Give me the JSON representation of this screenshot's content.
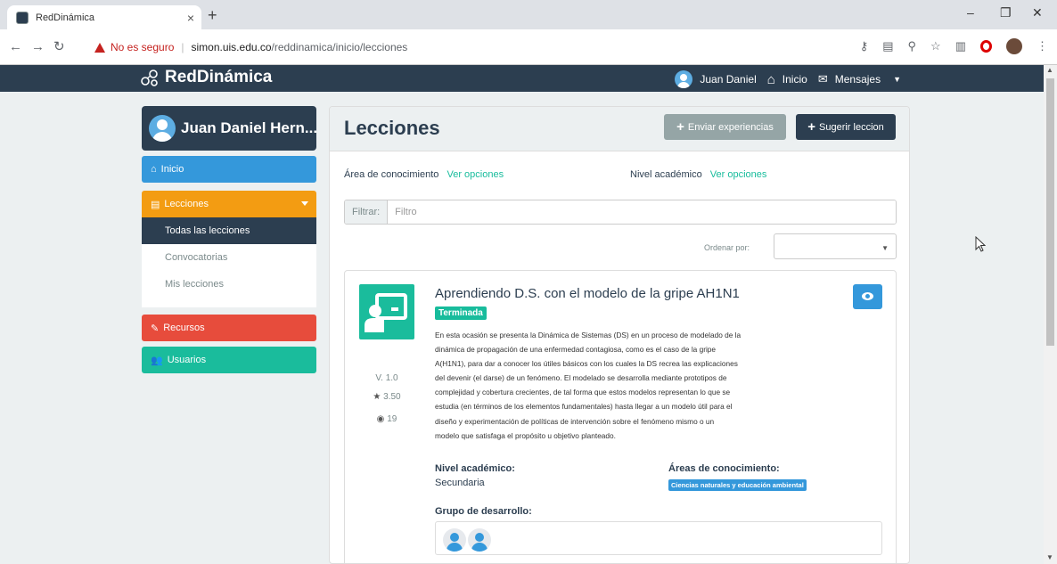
{
  "browser": {
    "tab_title": "RedDinámica",
    "tab_close": "×",
    "new_tab": "+",
    "not_secure": "No es seguro",
    "url_host": "simon.uis.edu.co",
    "url_path": "/reddinamica/inicio/lecciones",
    "window_controls": [
      "–",
      "❐",
      "✕"
    ]
  },
  "site": {
    "brand": "RedDinámica",
    "user_short": "Juan Daniel",
    "nav_inicio": "Inicio",
    "nav_mensajes": "Mensajes"
  },
  "sidebar": {
    "user_name": "Juan Daniel Hern...",
    "inicio": "Inicio",
    "lecciones": "Lecciones",
    "submenu": [
      "Todas las lecciones",
      "Convocatorias",
      "Mis lecciones"
    ],
    "recursos": "Recursos",
    "usuarios": "Usuarios"
  },
  "main": {
    "title": "Lecciones",
    "btn_enviar": "Enviar experiencias",
    "btn_sugerir": "Sugerir leccion",
    "area_label": "Área de conocimiento",
    "area_link": "Ver opciones",
    "nivel_label": "Nivel académico",
    "nivel_link": "Ver opciones",
    "filter_addon": "Filtrar:",
    "filter_placeholder": "Filtro",
    "sort_label": "Ordenar por:"
  },
  "lesson": {
    "title": "Aprendiendo D.S. con el modelo de la gripe AH1N1",
    "status": "Terminada",
    "version": "V. 1.0",
    "rating": "3.50",
    "views": "19",
    "description_lines": [
      "En esta ocasión se presenta la Dinámica de Sistemas (DS) en un proceso de modelado de la",
      "dinámica de propagación de una enfermedad contagiosa, como es el caso de la gripe",
      "A(H1N1), para dar a conocer los útiles básicos con los cuales la DS recrea las explicaciones",
      "del devenir (el darse) de un fenómeno. El modelado se desarrolla mediante prototipos de",
      "complejidad y cobertura crecientes, de tal forma que estos modelos representan lo que se",
      "estudia (en términos de los elementos fundamentales) hasta llegar a un modelo útil para el",
      "diseño y experimentación de políticas de intervención sobre el fenómeno mismo o un",
      "modelo que satisfaga el propósito u objetivo planteado."
    ],
    "nivel_label": "Nivel académico:",
    "nivel_value": "Secundaria",
    "areas_label": "Áreas de conocimiento:",
    "area_badge": "Ciencias naturales y educación ambiental",
    "grupo_label": "Grupo de desarrollo:"
  },
  "colors": {
    "header": "#2c3e50",
    "inicio": "#3498db",
    "lecciones": "#f39c12",
    "recursos": "#e74c3c",
    "usuarios": "#1abc9c",
    "status": "#18bc9c"
  }
}
